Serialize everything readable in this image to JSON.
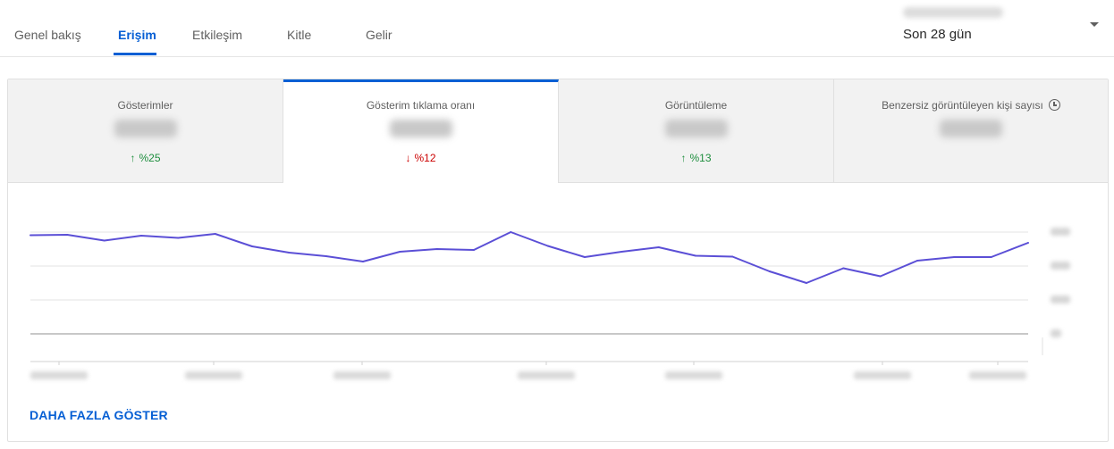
{
  "tabs": [
    "Genel bakış",
    "Erişim",
    "Etkileşim",
    "Kitle",
    "Gelir"
  ],
  "active_tab": "Erişim",
  "period": {
    "label": "Son 28 gün"
  },
  "metrics": [
    {
      "label": "Gösterimler",
      "delta": "%25",
      "direction": "up"
    },
    {
      "label": "Gösterim tıklama oranı",
      "delta": "%12",
      "direction": "down"
    },
    {
      "label": "Görüntüleme",
      "delta": "%13",
      "direction": "up"
    },
    {
      "label": "Benzersiz görüntüleyen kişi sayısı",
      "icon": "clock-icon"
    }
  ],
  "selected_metric": "Gösterim tıklama oranı",
  "colors": {
    "accent": "#065fd4",
    "line": "#5b4fd6",
    "up": "#1e8e3e",
    "down": "#cc0000"
  },
  "chart_data": {
    "type": "line",
    "series_color": "#5b4fd6",
    "values": [
      263.5,
      263,
      269.5,
      264,
      266.5,
      262,
      276,
      283,
      287,
      293,
      282,
      279,
      280,
      260,
      275.5,
      288,
      282,
      277,
      286.5,
      287.5,
      304,
      317,
      300.5,
      309.5,
      292,
      288,
      288,
      272
    ]
  },
  "show_more": "DAHA FAZLA GÖSTER"
}
